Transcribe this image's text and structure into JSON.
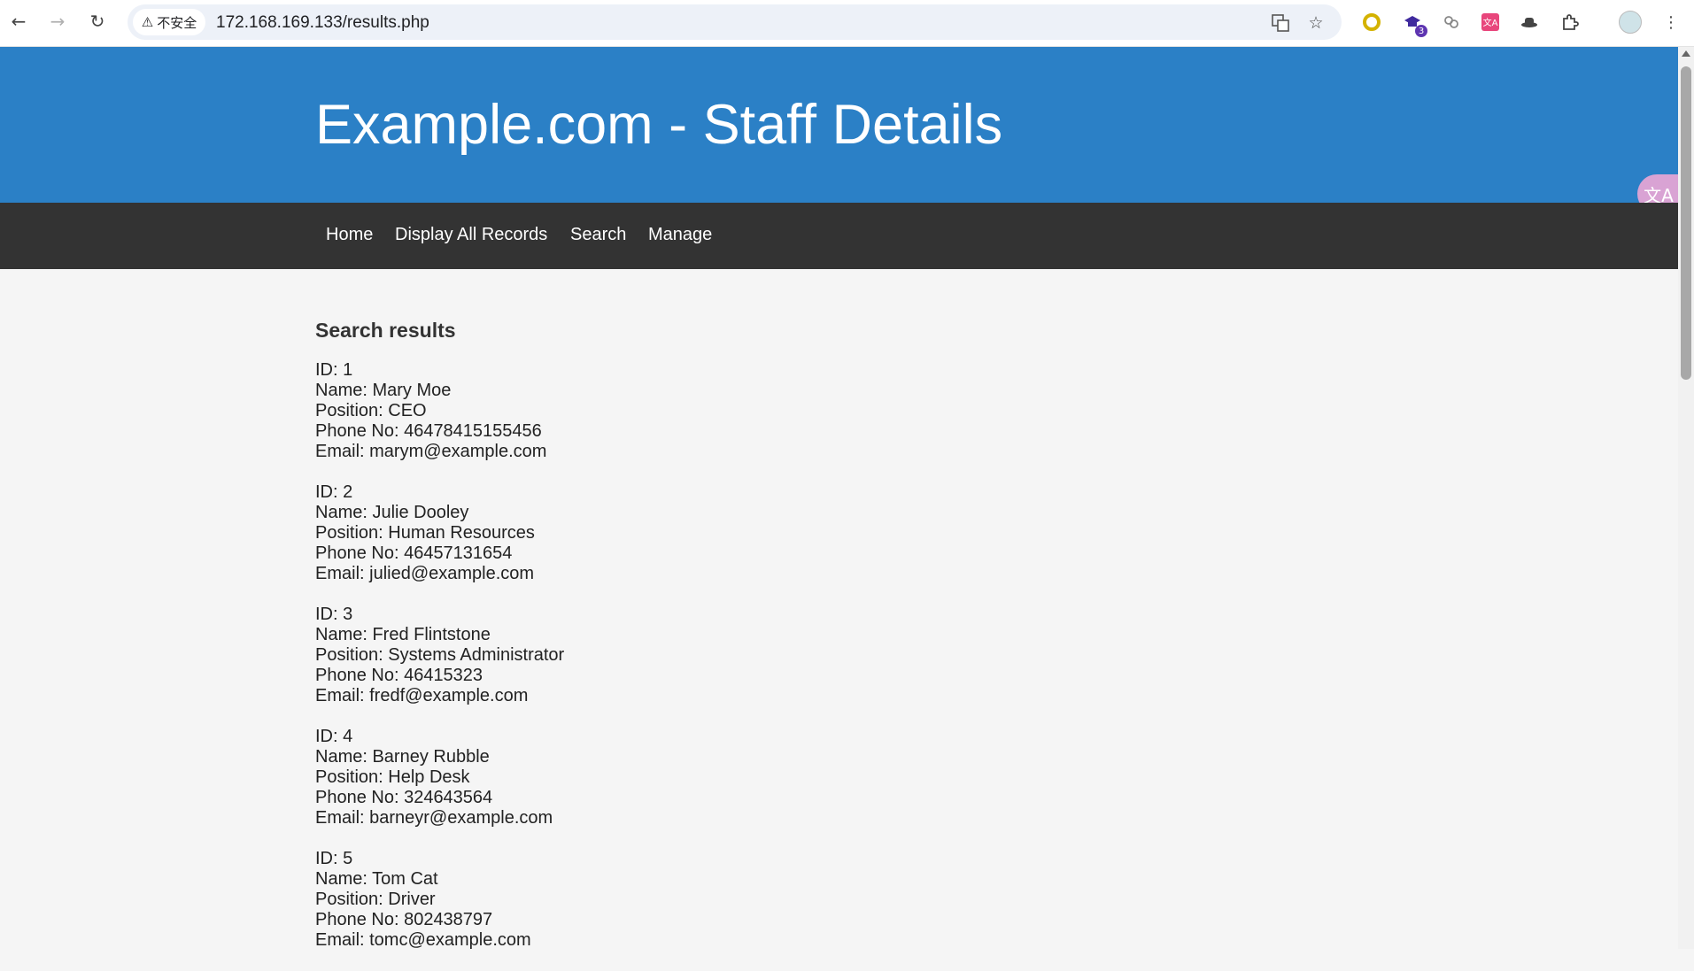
{
  "browser": {
    "security_label": "不安全",
    "url": "172.168.169.133/results.php",
    "extension_badge": "3"
  },
  "site": {
    "title": "Example.com - Staff Details"
  },
  "nav": {
    "items": [
      "Home",
      "Display All Records",
      "Search",
      "Manage"
    ]
  },
  "results": {
    "heading": "Search results",
    "records": [
      {
        "id": "ID: 1",
        "name": "Name: Mary Moe",
        "position": "Position: CEO",
        "phone": "Phone No: 46478415155456",
        "email": "Email: marym@example.com"
      },
      {
        "id": "ID: 2",
        "name": "Name: Julie Dooley",
        "position": "Position: Human Resources",
        "phone": "Phone No: 46457131654",
        "email": "Email: julied@example.com"
      },
      {
        "id": "ID: 3",
        "name": "Name: Fred Flintstone",
        "position": "Position: Systems Administrator",
        "phone": "Phone No: 46415323",
        "email": "Email: fredf@example.com"
      },
      {
        "id": "ID: 4",
        "name": "Name: Barney Rubble",
        "position": "Position: Help Desk",
        "phone": "Phone No: 324643564",
        "email": "Email: barneyr@example.com"
      },
      {
        "id": "ID: 5",
        "name": "Name: Tom Cat",
        "position": "Position: Driver",
        "phone": "Phone No: 802438797",
        "email": "Email: tomc@example.com"
      }
    ]
  },
  "colors": {
    "header_bg": "#2b80c6",
    "navbar_bg": "#333333",
    "page_bg": "#f5f5f5"
  }
}
